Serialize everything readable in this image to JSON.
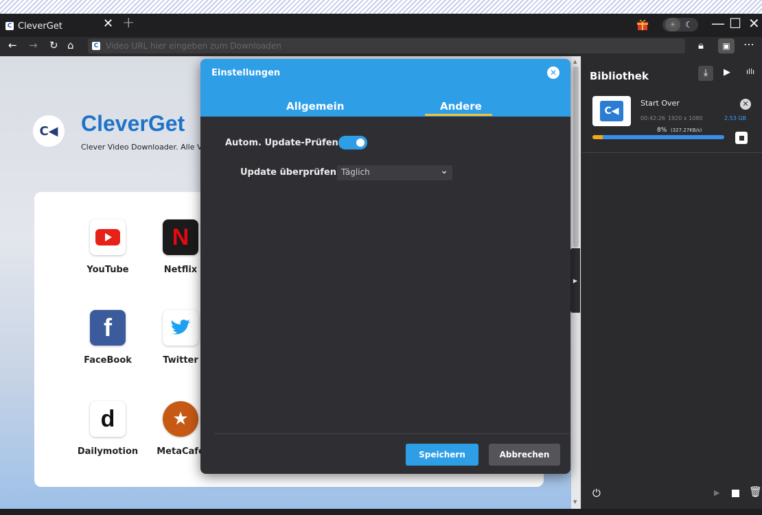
{
  "tab": {
    "title": "CleverGet",
    "close": "✕",
    "new": "+"
  },
  "window": {
    "minimize": "—",
    "maximize": "☐",
    "close": "✕"
  },
  "address": {
    "placeholder": "Video URL hier eingeben zum Downloaden"
  },
  "brand": {
    "name_a": "Clever",
    "name_b": "Get",
    "tagline": "Clever Video Downloader. Alle Vide"
  },
  "sites": [
    {
      "label": "YouTube"
    },
    {
      "label": "Netflix"
    },
    {
      "label": "FaceBook"
    },
    {
      "label": "Twitter"
    },
    {
      "label": "Dailymotion"
    },
    {
      "label": "MetaCafe"
    }
  ],
  "library": {
    "title": "Bibliothek",
    "item": {
      "title": "Start Over",
      "duration": "00:42:26",
      "resolution": "1920 x 1080",
      "size": "2.53 GB",
      "percent": "8%",
      "speed": "(327.27KB/s)",
      "progress": 0.08
    }
  },
  "modal": {
    "title": "Einstellungen",
    "tabs": [
      "Allgemein",
      "Andere"
    ],
    "active_tab": "Andere",
    "auto_update_label": "Autom. Update-Prüfen:",
    "auto_update_on": true,
    "update_check_label": "Update überprüfen:",
    "update_check_value": "Täglich",
    "save": "Speichern",
    "cancel": "Abbrechen"
  },
  "colors": {
    "accent": "#2e9ee6",
    "brand": "#1e73c8",
    "progress_fill": "#f1a81a",
    "tab_underline": "#f3c23a"
  }
}
